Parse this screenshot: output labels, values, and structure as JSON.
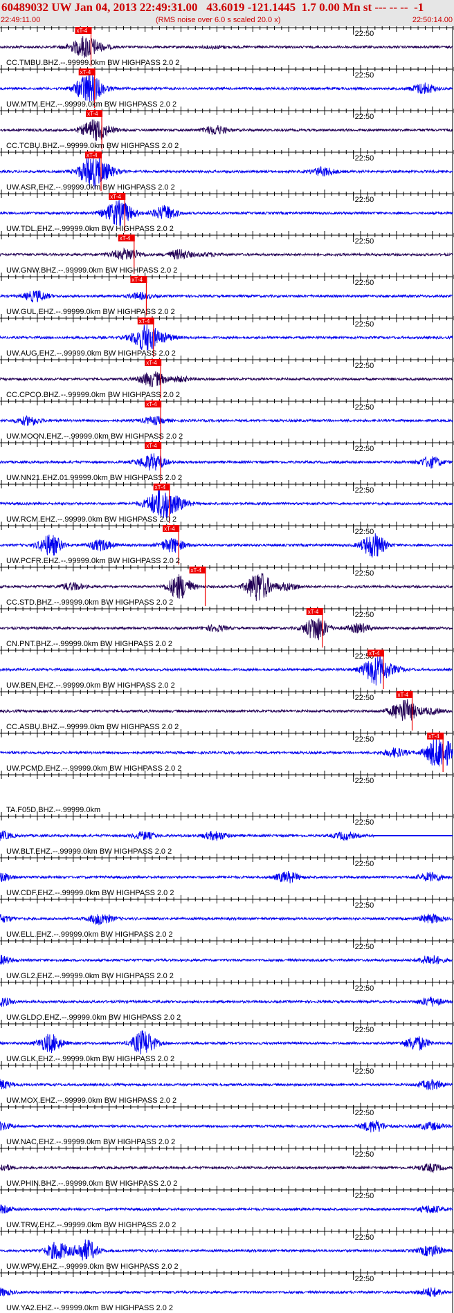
{
  "header": {
    "title": "60489032 UW Jan 04, 2013 22:49:31.00   43.6019 -121.1445  1.7 0.00 Mn st --- -- --  -1",
    "start_time": "22:49:11.00",
    "end_time": "22:50:14.00",
    "rms_note": "(RMS noise over 6.0 s scaled 20.0 x)"
  },
  "chart_data": {
    "type": "seismogram",
    "time_range": [
      "22:49:11.00",
      "22:50:14.00"
    ],
    "minute_marker": "22:50",
    "pick_label": "xT-4",
    "colors": {
      "blue": "#0000ee",
      "navy": "#220055",
      "pick": "#ee0000",
      "axis": "#000000"
    },
    "traces": [
      {
        "label": "CC.TMBU.BHZ.--.99999.0km BW  HIGHPASS  2.0  2",
        "color": "navy",
        "pick": 11.8,
        "env": [
          [
            10,
            0.5
          ],
          [
            12,
            3
          ],
          [
            14,
            0.5
          ],
          [
            30,
            0.3
          ]
        ]
      },
      {
        "label": "UW.MTM.EHZ.--.99999.0km BW  HIGHPASS  2.0  2",
        "color": "blue",
        "pick": 12.3,
        "env": [
          [
            11,
            0.4
          ],
          [
            12.3,
            4
          ],
          [
            14,
            0.6
          ],
          [
            59,
            1.5
          ]
        ]
      },
      {
        "label": "CC.TCBU.BHZ.--.99999.0km BW  HIGHPASS  2.0  2",
        "color": "navy",
        "pick": 13.3,
        "env": [
          [
            12,
            0.5
          ],
          [
            13.3,
            2.5
          ],
          [
            15,
            0.6
          ],
          [
            30,
            1.2
          ]
        ]
      },
      {
        "label": "UW.ASR.EHZ.--.99999.0km BW  HIGHPASS  2.0  2",
        "color": "blue",
        "pick": 13.2,
        "env": [
          [
            12,
            1
          ],
          [
            13,
            4
          ],
          [
            15,
            1.2
          ],
          [
            45,
            1.2
          ]
        ]
      },
      {
        "label": "UW.TDL.EHZ.--.99999.0km BW  HIGHPASS  2.0  2",
        "color": "blue",
        "pick": 16.5,
        "env": [
          [
            15,
            0.6
          ],
          [
            16.5,
            3
          ],
          [
            18,
            0.7
          ],
          [
            23,
            2
          ]
        ]
      },
      {
        "label": "UW.GNW.BHZ.--.99999.0km BW  HIGHPASS  2.0  2",
        "color": "navy",
        "pick": 17.8,
        "env": [
          [
            16,
            0.5
          ],
          [
            18,
            1.5
          ],
          [
            25,
            1.3
          ],
          [
            29,
            0.4
          ]
        ]
      },
      {
        "label": "UW.GUL.EHZ.--.99999.0km BW  HIGHPASS  2.0  2",
        "color": "blue",
        "pick": 19.5,
        "env": [
          [
            5,
            1.5
          ],
          [
            19.5,
            0.8
          ]
        ]
      },
      {
        "label": "UW.AUG.EHZ.--.99999.0km BW  HIGHPASS  2.0  2",
        "color": "blue",
        "pick": 20.5,
        "env": [
          [
            19,
            0.8
          ],
          [
            20.5,
            3.5
          ],
          [
            23,
            0.8
          ]
        ]
      },
      {
        "label": "CC.CPCO.BHZ.--.99999.0km BW  HIGHPASS  2.0  2",
        "color": "navy",
        "pick": 21.5,
        "env": [
          [
            20,
            0.5
          ],
          [
            21.5,
            1.8
          ],
          [
            25,
            0.6
          ]
        ]
      },
      {
        "label": "UW.MOON.EHZ.--.99999.0km BW  HIGHPASS  2.0  2",
        "color": "blue",
        "pick": 21.5,
        "env": [
          [
            4,
            1.2
          ],
          [
            21.5,
            1
          ]
        ]
      },
      {
        "label": "UW.NN21.EHZ.01.99999.0km BW  HIGHPASS  2.0  2",
        "color": "blue",
        "pick": 21.5,
        "env": [
          [
            20,
            0.6
          ],
          [
            21.5,
            2
          ],
          [
            60,
            1.5
          ]
        ]
      },
      {
        "label": "UW.RCM.EHZ.--.99999.0km BW  HIGHPASS  2.0  2",
        "color": "blue",
        "pick": 22.7,
        "env": [
          [
            21,
            1
          ],
          [
            22.7,
            4
          ],
          [
            25,
            1.2
          ]
        ]
      },
      {
        "label": "UW.PCFR.EHZ.--.99999.0km BW  HIGHPASS  2.0  2",
        "color": "blue",
        "pick": 24,
        "env": [
          [
            7,
            3
          ],
          [
            14,
            1.5
          ],
          [
            24,
            2
          ],
          [
            52,
            3.5
          ]
        ]
      },
      {
        "label": "CC.STD.BHZ.--.99999.0km BW  HIGHPASS  2.0  2",
        "color": "navy",
        "pick": 27.7,
        "env": [
          [
            10,
            1
          ],
          [
            25,
            3.5
          ],
          [
            36,
            4.5
          ],
          [
            40,
            1
          ]
        ]
      },
      {
        "label": "CN.PNT.BHZ.--.99999.0km BW  HIGHPASS  2.0  2",
        "color": "navy",
        "pick": 44,
        "env": [
          [
            30,
            0.8
          ],
          [
            44,
            3.5
          ],
          [
            50,
            1.2
          ]
        ]
      },
      {
        "label": "UW.BEN.EHZ.--.99999.0km BW  HIGHPASS  2.0  2",
        "color": "blue",
        "pick": 52.5,
        "env": [
          [
            51,
            0.6
          ],
          [
            52.5,
            4
          ],
          [
            55,
            0.6
          ]
        ]
      },
      {
        "label": "CC.ASBU.BHZ.--.99999.0km BW  HIGHPASS  2.0  2",
        "color": "navy",
        "pick": 56.5,
        "env": [
          [
            55,
            0.6
          ],
          [
            56.5,
            3
          ],
          [
            60,
            0.8
          ]
        ]
      },
      {
        "label": "UW.PCMD.EHZ.--.99999.0km BW  HIGHPASS  2.0  2",
        "color": "blue",
        "pick": 60.8,
        "env": [
          [
            55,
            1.2
          ],
          [
            60.8,
            3.5
          ],
          [
            62,
            2
          ]
        ]
      },
      {
        "label": "TA.F05D.BHZ.--.99999.0km",
        "color": "blue",
        "pick": null,
        "env": [],
        "flat": true
      },
      {
        "label": "UW.BLT.EHZ.--.99999.0km BW  HIGHPASS  2.0  2",
        "color": "blue",
        "pick": null,
        "env": [
          [
            0,
            1.2
          ],
          [
            20,
            1
          ],
          [
            30,
            1.2
          ],
          [
            48,
            1
          ]
        ],
        "gap_after": 52
      },
      {
        "label": "UW.CDF.EHZ.--.99999.0km BW  HIGHPASS  2.0  2",
        "color": "blue",
        "pick": null,
        "env": [
          [
            0,
            1.2
          ],
          [
            40,
            1.5
          ],
          [
            60,
            1.2
          ]
        ]
      },
      {
        "label": "UW.ELL.EHZ.--.99999.0km BW  HIGHPASS  2.0  2",
        "color": "blue",
        "pick": null,
        "env": [
          [
            0,
            1
          ],
          [
            14,
            1.6
          ],
          [
            60,
            1.2
          ]
        ]
      },
      {
        "label": "UW.GL2.EHZ.--.99999.0km BW  HIGHPASS  2.0  2",
        "color": "blue",
        "pick": null,
        "env": [
          [
            0,
            1.2
          ],
          [
            60,
            1.3
          ]
        ]
      },
      {
        "label": "UW.GLDO.EHZ.--.99999.0km BW  HIGHPASS  2.0  2",
        "color": "blue",
        "pick": null,
        "env": [
          [
            0,
            1.2
          ],
          [
            60,
            1.2
          ]
        ]
      },
      {
        "label": "UW.GLK.EHZ.--.99999.0km BW  HIGHPASS  2.0  2",
        "color": "blue",
        "pick": null,
        "env": [
          [
            7,
            2.5
          ],
          [
            20,
            3.5
          ],
          [
            58,
            2
          ]
        ]
      },
      {
        "label": "UW.MOX.EHZ.--.99999.0km BW  HIGHPASS  2.0  2",
        "color": "blue",
        "pick": null,
        "env": [
          [
            0,
            1.3
          ],
          [
            60,
            1.3
          ]
        ]
      },
      {
        "label": "UW.NAC.EHZ.--.99999.0km BW  HIGHPASS  2.0  2",
        "color": "blue",
        "pick": null,
        "env": [
          [
            0,
            1
          ],
          [
            52,
            1.6
          ],
          [
            60,
            1
          ]
        ]
      },
      {
        "label": "UW.PHIN.BHZ.--.99999.0km BW  HIGHPASS  2.0  2",
        "color": "navy",
        "pick": null,
        "env": [
          [
            0,
            1
          ],
          [
            60,
            1
          ]
        ]
      },
      {
        "label": "UW.TRW.EHZ.--.99999.0km BW  HIGHPASS  2.0  2",
        "color": "blue",
        "pick": null,
        "env": [
          [
            0,
            1
          ],
          [
            60,
            1
          ]
        ]
      },
      {
        "label": "UW.WPW.EHZ.--.99999.0km BW  HIGHPASS  2.0  2",
        "color": "blue",
        "pick": null,
        "env": [
          [
            8,
            2.5
          ],
          [
            12,
            3
          ],
          [
            60,
            1.5
          ]
        ]
      },
      {
        "label": "UW.YA2.EHZ.--.99999.0km BW  HIGHPASS  2.0  2",
        "color": "blue",
        "pick": null,
        "env": [
          [
            0,
            1
          ],
          [
            60,
            1.2
          ]
        ]
      }
    ]
  }
}
